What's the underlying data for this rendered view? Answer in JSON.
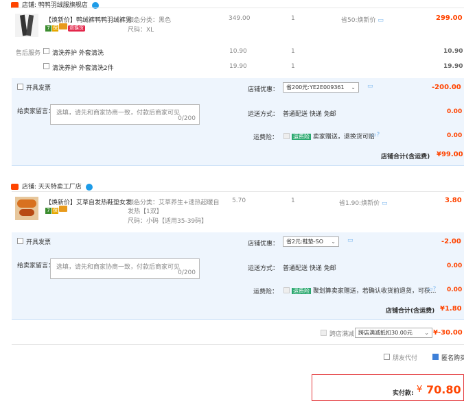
{
  "shop1": {
    "label": "店铺: 鸭鸭羽绒服旗舰店",
    "item": {
      "title": "【焕新价】鸭绒裤鸭鸭羽绒裤男...",
      "sku1": "颜色分类：黑色",
      "sku2": "尺码：XL",
      "tag7": "7",
      "tagY": "保",
      "tagR": "退换货",
      "price": "349.00",
      "qty": "1",
      "discount": "省50:焕新价",
      "total": "299.00"
    },
    "services_label": "售后服务",
    "services": [
      {
        "name": "清洗养护 外套清洗",
        "price": "10.90",
        "qty": "1",
        "total": "10.90"
      },
      {
        "name": "清洗养护 外套清洗2件",
        "price": "19.90",
        "qty": "1",
        "total": "19.90"
      }
    ],
    "invoice_label": "开具发票",
    "coupon_label": "店铺优惠：",
    "coupon_value": "省200元:YE2E009361",
    "coupon_amount": "-200.00",
    "message_label": "给卖家留言：",
    "message_placeholder": "选填，请先和商家协商一致，付款后商家可见",
    "message_count": "0/200",
    "delivery_label": "运送方式：",
    "delivery_value": "普通配送 快递 免邮",
    "delivery_amount": "0.00",
    "insurance_label": "运费险：",
    "insurance_tag": "运费险",
    "insurance_value": "卖家赠送，退换货可赔",
    "insurance_amount": "0.00",
    "shop_total_label": "店铺合计(含运费)",
    "shop_total": "¥99.00"
  },
  "shop2": {
    "label": "店铺: 天天特卖工厂店",
    "item": {
      "title": "【焕新价】艾草自发热鞋垫女发...",
      "sku1a": "颜色分类：艾草养生+速热超暖自",
      "sku1b": "发热【1双】",
      "sku2": "尺码：小码【适用35-39码】",
      "tag7": "7",
      "tagY": "保",
      "price": "5.70",
      "qty": "1",
      "discount": "省1.90:焕新价",
      "total": "3.80"
    },
    "invoice_label": "开具发票",
    "coupon_label": "店铺优惠：",
    "coupon_value": "省2元:鞋垫-SO",
    "coupon_amount": "-2.00",
    "message_label": "给卖家留言：",
    "message_placeholder": "选填，请先和商家协商一致，付款后商家可见",
    "message_count": "0/200",
    "delivery_label": "运送方式：",
    "delivery_value": "普通配送 快递 免邮",
    "delivery_amount": "0.00",
    "insurance_label": "运费险：",
    "insurance_tag": "运费险",
    "insurance_value": "聚划算卖家赠送，若确认收货前退货，可获...",
    "insurance_amount": "0.00",
    "shop_total_label": "店铺合计(含运费)",
    "shop_total": "¥1.80"
  },
  "cross_shop": {
    "label": "跨店满减",
    "value": "跨店满减抵扣30.00元",
    "amount": "¥-30.00"
  },
  "options": {
    "friend_pay": "朋友代付",
    "anonymous": "匿名购买"
  },
  "payment": {
    "label": "实付款:",
    "currency": "¥",
    "amount": "70.80"
  },
  "colors": {
    "accent": "#ff4400",
    "blue_panel": "#eef5fd",
    "total_border": "#e4393c"
  }
}
